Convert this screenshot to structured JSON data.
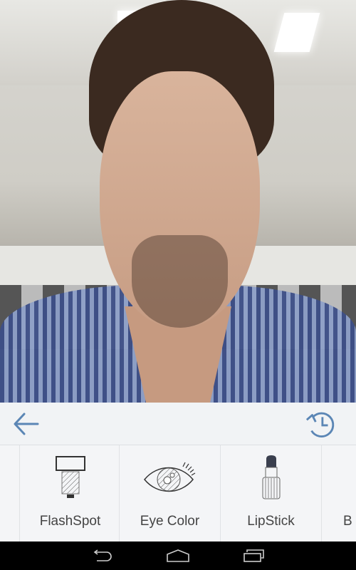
{
  "photo": {
    "description_icon": "selfie-photo"
  },
  "toolbar": {
    "back_icon": "arrow-left-icon",
    "history_icon": "history-icon",
    "accent": "#5b86b5"
  },
  "tools": [
    {
      "label": "FlashSpot",
      "icon": "flash-icon"
    },
    {
      "label": "Eye Color",
      "icon": "eye-icon"
    },
    {
      "label": "LipStick",
      "icon": "lipstick-icon"
    },
    {
      "label": "B",
      "icon": ""
    }
  ],
  "navbar": {
    "back": "nav-back-icon",
    "home": "nav-home-icon",
    "recents": "nav-recents-icon"
  }
}
